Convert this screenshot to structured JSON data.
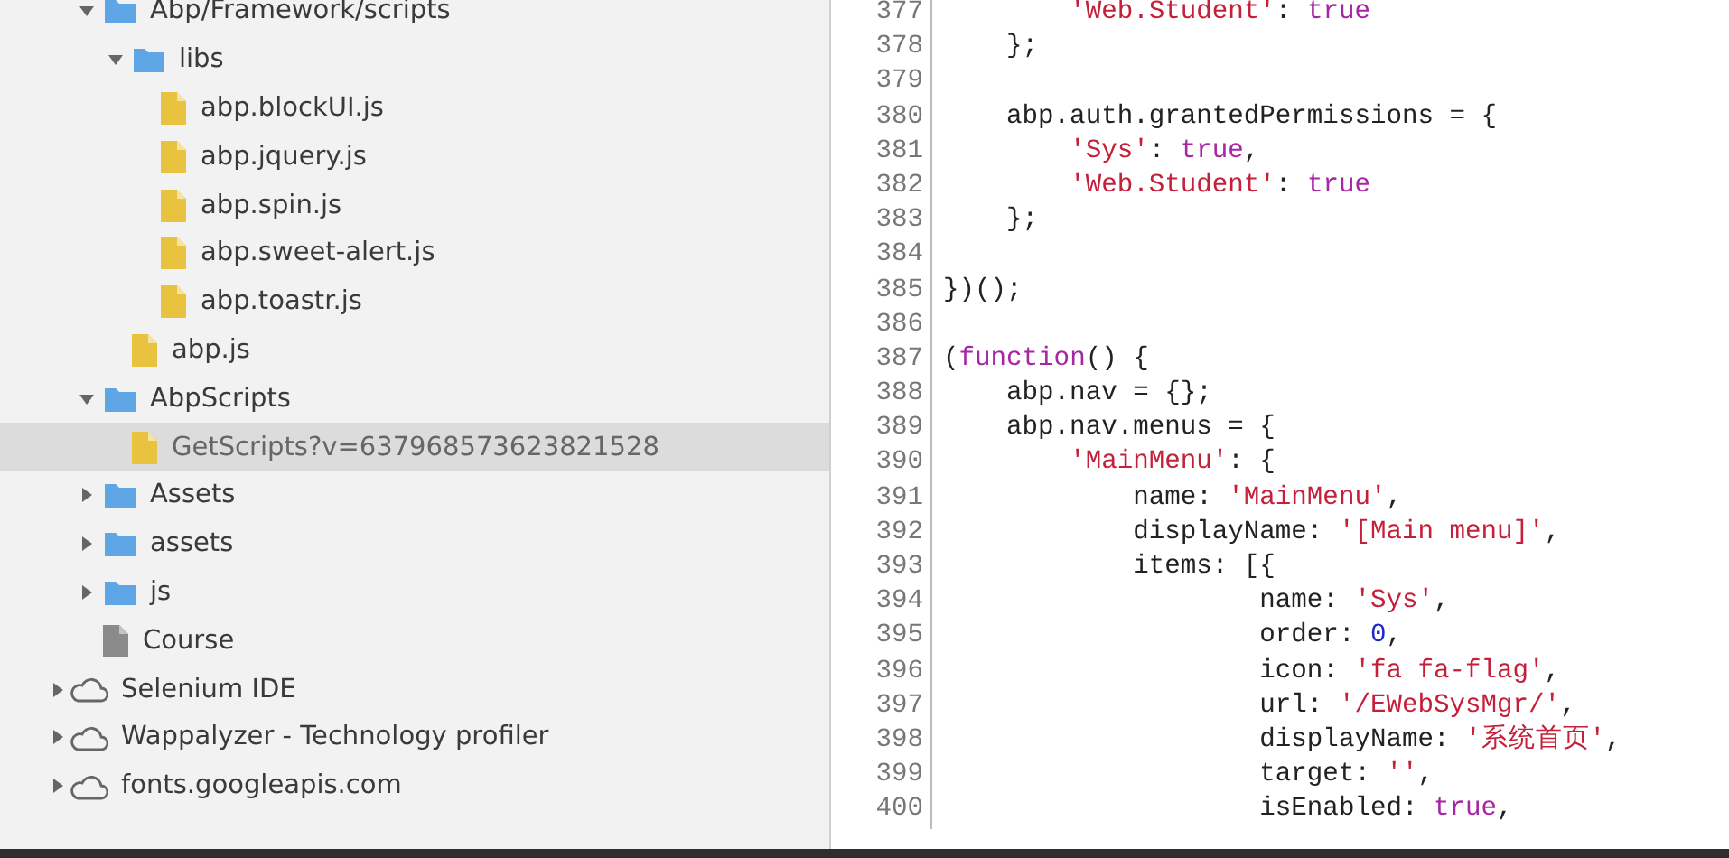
{
  "tree": [
    {
      "label": "Abp/Framework/scripts",
      "kind": "folder",
      "expanded": true,
      "selected": false,
      "children": [
        {
          "label": "libs",
          "kind": "folder",
          "expanded": true,
          "selected": false,
          "children": [
            {
              "label": "abp.blockUI.js",
              "kind": "script",
              "selected": false
            },
            {
              "label": "abp.jquery.js",
              "kind": "script",
              "selected": false
            },
            {
              "label": "abp.spin.js",
              "kind": "script",
              "selected": false
            },
            {
              "label": "abp.sweet-alert.js",
              "kind": "script",
              "selected": false
            },
            {
              "label": "abp.toastr.js",
              "kind": "script",
              "selected": false
            }
          ]
        },
        {
          "label": "abp.js",
          "kind": "script",
          "selected": false
        }
      ]
    },
    {
      "label": "AbpScripts",
      "kind": "folder",
      "expanded": true,
      "selected": false,
      "children": [
        {
          "label": "GetScripts?v=637968573623821528",
          "kind": "script",
          "selected": true
        }
      ]
    },
    {
      "label": "Assets",
      "kind": "folder",
      "expanded": false,
      "selected": false
    },
    {
      "label": "assets",
      "kind": "folder",
      "expanded": false,
      "selected": false
    },
    {
      "label": "js",
      "kind": "folder",
      "expanded": false,
      "selected": false
    },
    {
      "label": "Course",
      "kind": "document",
      "selected": false
    }
  ],
  "origins": [
    {
      "label": "Selenium IDE",
      "kind": "domain",
      "expanded": false,
      "selected": false
    },
    {
      "label": "Wappalyzer - Technology profiler",
      "kind": "domain",
      "expanded": false,
      "selected": false
    },
    {
      "label": "fonts.googleapis.com",
      "kind": "domain",
      "expanded": false,
      "selected": false
    }
  ],
  "code": [
    {
      "number": "377",
      "tokens": [
        {
          "text": "        'Web.Student'",
          "kind": "string"
        },
        {
          "text": ": ",
          "kind": "plain"
        },
        {
          "text": "true",
          "kind": "keyword"
        }
      ]
    },
    {
      "number": "378",
      "tokens": [
        {
          "text": "    };",
          "kind": "plain"
        }
      ]
    },
    {
      "number": "379"
    },
    {
      "number": "380",
      "tokens": [
        {
          "text": "    abp.auth.grantedPermissions = {",
          "kind": "plain"
        }
      ]
    },
    {
      "number": "381",
      "tokens": [
        {
          "text": "        'Sys'",
          "kind": "string"
        },
        {
          "text": ": ",
          "kind": "plain"
        },
        {
          "text": "true",
          "kind": "keyword"
        },
        {
          "text": ",",
          "kind": "plain"
        }
      ]
    },
    {
      "number": "382",
      "tokens": [
        {
          "text": "        'Web.Student'",
          "kind": "string"
        },
        {
          "text": ": ",
          "kind": "plain"
        },
        {
          "text": "true",
          "kind": "keyword"
        }
      ]
    },
    {
      "number": "383",
      "tokens": [
        {
          "text": "    };",
          "kind": "plain"
        }
      ]
    },
    {
      "number": "384"
    },
    {
      "number": "385",
      "tokens": [
        {
          "text": "})();",
          "kind": "plain"
        }
      ]
    },
    {
      "number": "386"
    },
    {
      "number": "387",
      "tokens": [
        {
          "text": "(",
          "kind": "plain"
        },
        {
          "text": "function",
          "kind": "keyword"
        },
        {
          "text": "() {",
          "kind": "plain"
        }
      ]
    },
    {
      "number": "388",
      "tokens": [
        {
          "text": "    abp.nav = {};",
          "kind": "plain"
        }
      ]
    },
    {
      "number": "389",
      "tokens": [
        {
          "text": "    abp.nav.menus = {",
          "kind": "plain"
        }
      ]
    },
    {
      "number": "390",
      "tokens": [
        {
          "text": "        'MainMenu'",
          "kind": "string"
        },
        {
          "text": ": {",
          "kind": "plain"
        }
      ]
    },
    {
      "number": "391",
      "tokens": [
        {
          "text": "            name: ",
          "kind": "plain"
        },
        {
          "text": "'MainMenu'",
          "kind": "string"
        },
        {
          "text": ",",
          "kind": "plain"
        }
      ]
    },
    {
      "number": "392",
      "tokens": [
        {
          "text": "            displayName: ",
          "kind": "plain"
        },
        {
          "text": "'[Main menu]'",
          "kind": "string"
        },
        {
          "text": ",",
          "kind": "plain"
        }
      ]
    },
    {
      "number": "393",
      "tokens": [
        {
          "text": "            items: [{",
          "kind": "plain"
        }
      ]
    },
    {
      "number": "394",
      "tokens": [
        {
          "text": "                    name: ",
          "kind": "plain"
        },
        {
          "text": "'Sys'",
          "kind": "string"
        },
        {
          "text": ",",
          "kind": "plain"
        }
      ]
    },
    {
      "number": "395",
      "tokens": [
        {
          "text": "                    order: ",
          "kind": "plain"
        },
        {
          "text": "0",
          "kind": "number"
        },
        {
          "text": ",",
          "kind": "plain"
        }
      ]
    },
    {
      "number": "396",
      "tokens": [
        {
          "text": "                    icon: ",
          "kind": "plain"
        },
        {
          "text": "'fa fa-flag'",
          "kind": "string"
        },
        {
          "text": ",",
          "kind": "plain"
        }
      ]
    },
    {
      "number": "397",
      "tokens": [
        {
          "text": "                    url: ",
          "kind": "plain"
        },
        {
          "text": "'/EWebSysMgr/'",
          "kind": "string"
        },
        {
          "text": ",",
          "kind": "plain"
        }
      ]
    },
    {
      "number": "398",
      "tokens": [
        {
          "text": "                    displayName: ",
          "kind": "plain"
        },
        {
          "text": "'系统首页'",
          "kind": "string"
        },
        {
          "text": ",",
          "kind": "plain"
        }
      ]
    },
    {
      "number": "399",
      "tokens": [
        {
          "text": "                    target: ",
          "kind": "plain"
        },
        {
          "text": "''",
          "kind": "string"
        },
        {
          "text": ",",
          "kind": "plain"
        }
      ]
    },
    {
      "number": "400",
      "tokens": [
        {
          "text": "                    isEnabled: ",
          "kind": "plain"
        },
        {
          "text": "true",
          "kind": "keyword"
        },
        {
          "text": ",",
          "kind": "plain"
        }
      ]
    }
  ]
}
